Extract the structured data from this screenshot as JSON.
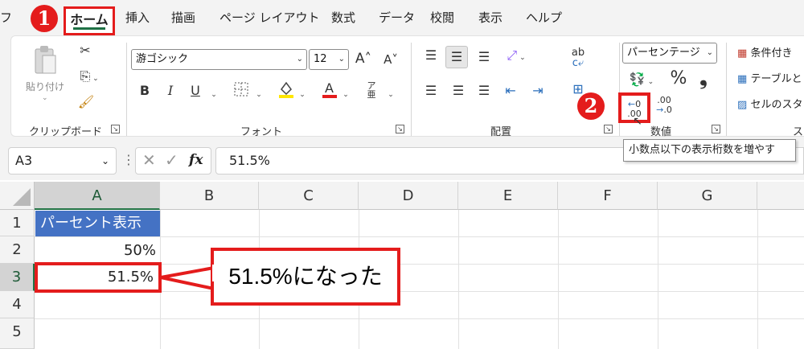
{
  "menu": {
    "file_partial": "フ",
    "tabs": [
      "ホーム",
      "挿入",
      "描画",
      "ページ レイアウト",
      "数式",
      "データ",
      "校閲",
      "表示",
      "ヘルプ"
    ]
  },
  "badges": {
    "step1": "1",
    "step2": "2"
  },
  "ribbon": {
    "clipboard": {
      "paste_label": "貼り付け",
      "group_label": "クリップボード"
    },
    "font": {
      "font_name": "游ゴシック",
      "font_size": "12",
      "bold": "B",
      "italic": "I",
      "underline": "U",
      "group_label": "フォント"
    },
    "alignment": {
      "group_label": "配置"
    },
    "number": {
      "format": "パーセンテージ",
      "percent": "%",
      "comma": "❟",
      "group_label": "数値"
    },
    "styles": {
      "items": [
        "条件付き",
        "テーブルと",
        "セルのスタ"
      ],
      "group_label_partial": "ス"
    }
  },
  "tooltip": "小数点以下の表示桁数を増やす",
  "formula_bar": {
    "name_box": "A3",
    "fx": "fx",
    "value": "51.5%"
  },
  "columns": [
    "A",
    "B",
    "C",
    "D",
    "E",
    "F",
    "G"
  ],
  "rows": [
    "1",
    "2",
    "3",
    "4",
    "5"
  ],
  "cells": {
    "A1": "パーセント表示",
    "A2": "50%",
    "A3": "51.5%"
  },
  "callout": "51.5%になった",
  "colors": {
    "accent_red": "#e41c1c",
    "excel_green": "#217346",
    "header_fill": "#4472c4"
  }
}
